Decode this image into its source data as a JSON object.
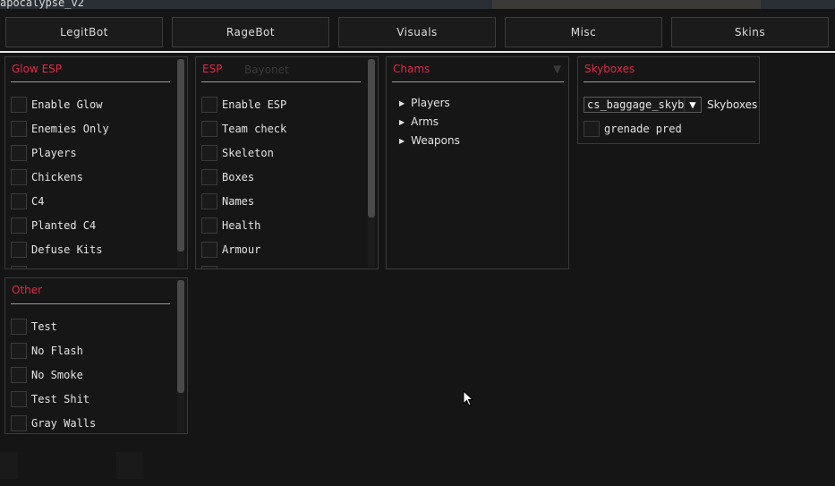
{
  "window": {
    "title": "apocalypse_v2"
  },
  "tabs": [
    {
      "label": "LegitBot"
    },
    {
      "label": "RageBot"
    },
    {
      "label": "Visuals"
    },
    {
      "label": "Misc"
    },
    {
      "label": "Skins"
    }
  ],
  "panels": {
    "glow_esp": {
      "title": "Glow ESP",
      "items": [
        {
          "label": "Enable Glow",
          "checked": false
        },
        {
          "label": "Enemies Only",
          "checked": false
        },
        {
          "label": "Players",
          "checked": false
        },
        {
          "label": "Chickens",
          "checked": false
        },
        {
          "label": "C4",
          "checked": false
        },
        {
          "label": "Planted C4",
          "checked": false
        },
        {
          "label": "Defuse Kits",
          "checked": false
        }
      ]
    },
    "esp": {
      "title": "ESP",
      "items": [
        {
          "label": "Enable ESP",
          "checked": false
        },
        {
          "label": "Team check",
          "checked": false
        },
        {
          "label": "Skeleton",
          "checked": false
        },
        {
          "label": "Boxes",
          "checked": false
        },
        {
          "label": "Names",
          "checked": false
        },
        {
          "label": "Health",
          "checked": false
        },
        {
          "label": "Armour",
          "checked": false
        }
      ],
      "ghost_text": "Bayonet"
    },
    "chams": {
      "title": "Chams",
      "tree": [
        {
          "label": "Players"
        },
        {
          "label": "Arms"
        },
        {
          "label": "Weapons"
        }
      ]
    },
    "skyboxes": {
      "title": "Skyboxes",
      "combo_value": "cs_baggage_skybox_",
      "combo_label": "Skyboxes",
      "items": [
        {
          "label": "grenade pred",
          "checked": false
        }
      ]
    },
    "other": {
      "title": "Other",
      "items": [
        {
          "label": "Test",
          "checked": false
        },
        {
          "label": "No Flash",
          "checked": false
        },
        {
          "label": "No Smoke",
          "checked": false
        },
        {
          "label": "Test Shit",
          "checked": false
        },
        {
          "label": "Gray Walls",
          "checked": false
        }
      ]
    }
  },
  "colors": {
    "accent": "#e0294a",
    "background": "#151515",
    "border": "#3a3a3a"
  }
}
